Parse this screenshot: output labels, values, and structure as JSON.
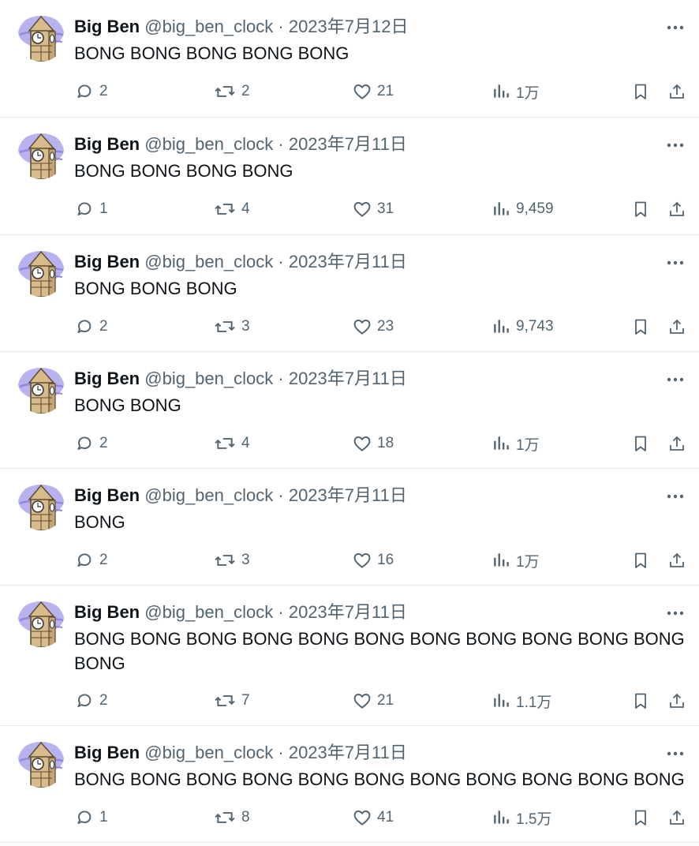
{
  "author": {
    "name": "Big Ben",
    "handle": "@big_ben_clock"
  },
  "icons": {
    "reply": "reply-icon",
    "retweet": "retweet-icon",
    "like": "heart-icon",
    "views": "views-icon",
    "bookmark": "bookmark-icon",
    "share": "share-icon",
    "more": "more-icon"
  },
  "tweets": [
    {
      "date": "2023年7月12日",
      "text": "BONG BONG BONG BONG BONG",
      "replies": "2",
      "retweets": "2",
      "likes": "21",
      "views": "1万"
    },
    {
      "date": "2023年7月11日",
      "text": "BONG BONG BONG BONG",
      "replies": "1",
      "retweets": "4",
      "likes": "31",
      "views": "9,459"
    },
    {
      "date": "2023年7月11日",
      "text": "BONG BONG BONG",
      "replies": "2",
      "retweets": "3",
      "likes": "23",
      "views": "9,743"
    },
    {
      "date": "2023年7月11日",
      "text": "BONG BONG",
      "replies": "2",
      "retweets": "4",
      "likes": "18",
      "views": "1万"
    },
    {
      "date": "2023年7月11日",
      "text": "BONG",
      "replies": "2",
      "retweets": "3",
      "likes": "16",
      "views": "1万"
    },
    {
      "date": "2023年7月11日",
      "text": "BONG BONG BONG BONG BONG BONG BONG BONG BONG BONG BONG BONG",
      "replies": "2",
      "retweets": "7",
      "likes": "21",
      "views": "1.1万"
    },
    {
      "date": "2023年7月11日",
      "text": "BONG BONG BONG BONG BONG BONG BONG BONG BONG BONG BONG",
      "replies": "1",
      "retweets": "8",
      "likes": "41",
      "views": "1.5万"
    }
  ]
}
